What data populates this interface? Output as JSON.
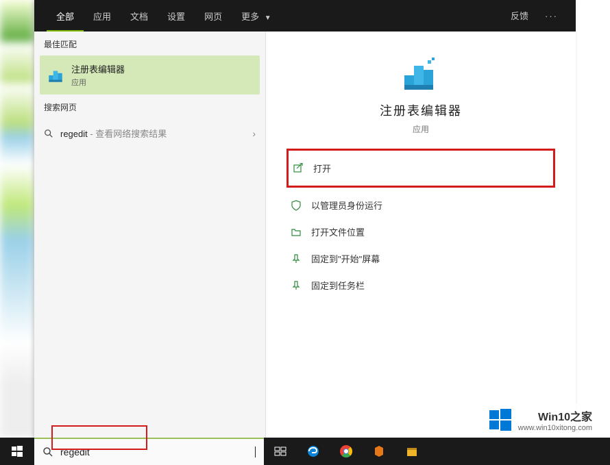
{
  "tabs": {
    "items": [
      {
        "label": "全部",
        "active": true
      },
      {
        "label": "应用"
      },
      {
        "label": "文档"
      },
      {
        "label": "设置"
      },
      {
        "label": "网页"
      },
      {
        "label": "更多",
        "has_dropdown": true
      }
    ],
    "feedback": "反馈"
  },
  "sections": {
    "best_match": "最佳匹配",
    "web_search": "搜索网页"
  },
  "best_match": {
    "title": "注册表编辑器",
    "subtitle": "应用"
  },
  "web_result": {
    "query": "regedit",
    "desc": " - 查看网络搜索结果"
  },
  "detail": {
    "title": "注册表编辑器",
    "subtitle": "应用",
    "actions": [
      {
        "label": "打开",
        "icon": "open-icon",
        "highlighted": true
      },
      {
        "label": "以管理员身份运行",
        "icon": "shield-icon"
      },
      {
        "label": "打开文件位置",
        "icon": "folder-icon"
      },
      {
        "label": "固定到\"开始\"屏幕",
        "icon": "pin-start-icon"
      },
      {
        "label": "固定到任务栏",
        "icon": "pin-taskbar-icon"
      }
    ]
  },
  "search": {
    "value": "regedit"
  },
  "watermark": {
    "title": "Win10之家",
    "url": "www.win10xitong.com"
  },
  "colors": {
    "accent": "#7fba00",
    "highlight_border": "#d41b1b",
    "best_match_bg": "#d4e8b8"
  }
}
